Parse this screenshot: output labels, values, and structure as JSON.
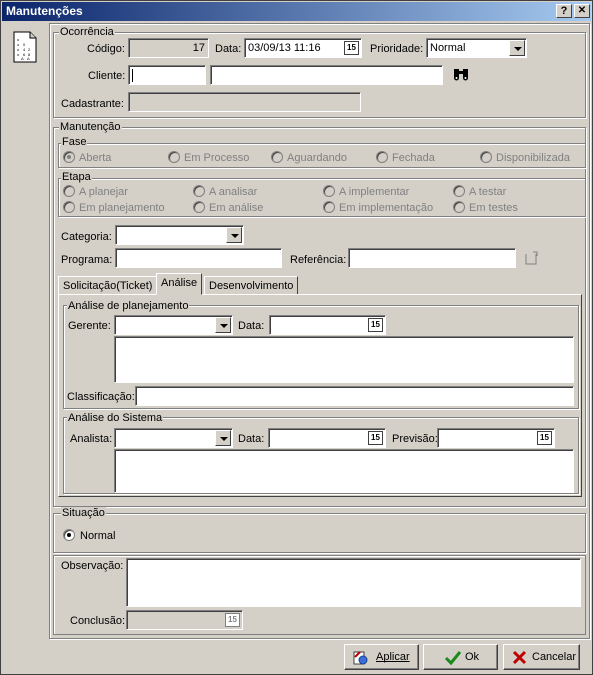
{
  "window": {
    "title": "Manutenções",
    "help_label": "?",
    "close_label": "✕"
  },
  "ocorrencia": {
    "group_label": "Ocorrência",
    "codigo_label": "Código:",
    "codigo_value": "17",
    "data_label": "Data:",
    "data_value": "03/09/13 11:16",
    "prioridade_label": "Prioridade:",
    "prioridade_value": "Normal",
    "cliente_label": "Cliente:",
    "cliente_code": "",
    "cliente_name": "",
    "cadastrante_label": "Cadastrante:",
    "cadastrante_value": ""
  },
  "manutencao": {
    "group_label": "Manutenção",
    "fase_label": "Fase",
    "fase_options": [
      "Aberta",
      "Em Processo",
      "Aguardando",
      "Fechada",
      "Disponibilizada"
    ],
    "fase_selected": "Aberta",
    "etapa_label": "Etapa",
    "etapa_options": [
      "A planejar",
      "A analisar",
      "A implementar",
      "A testar",
      "Em planejamento",
      "Em análise",
      "Em implementação",
      "Em testes"
    ],
    "categoria_label": "Categoria:",
    "categoria_value": "",
    "programa_label": "Programa:",
    "programa_value": "",
    "referencia_label": "Referência:",
    "referencia_value": ""
  },
  "tabs": [
    {
      "label": "Solicitação(Ticket)"
    },
    {
      "label": "Análise"
    },
    {
      "label": "Desenvolvimento"
    }
  ],
  "active_tab": "Análise",
  "analise_planejamento": {
    "group_label": "Análise de planejamento",
    "gerente_label": "Gerente:",
    "gerente_value": "",
    "data_label": "Data:",
    "data_value": "",
    "classificacao_label": "Classificação:",
    "classificacao_value": ""
  },
  "analise_sistema": {
    "group_label": "Análise do Sistema",
    "analista_label": "Analista:",
    "analista_value": "",
    "data_label": "Data:",
    "data_value": "",
    "previsao_label": "Previsão:",
    "previsao_value": ""
  },
  "situacao": {
    "group_label": "Situação",
    "option": "Normal"
  },
  "observacao_label": "Observação:",
  "observacao_value": "",
  "conclusao_label": "Conclusão:",
  "conclusao_value": "",
  "buttons": {
    "aplicar": "Aplicar",
    "ok": "Ok",
    "cancelar": "Cancelar"
  },
  "icons": {
    "form": "document-icon",
    "search": "binoculars-icon",
    "calendar": "calendar-icon",
    "new_ref": "new-document-icon",
    "aplicar": "apply-icon",
    "ok": "checkmark-icon",
    "cancelar": "red-x-icon"
  },
  "colors": {
    "title_start": "#0a246a",
    "title_end": "#a6caf0",
    "ok_check": "#1a8a1a",
    "cancel_x": "#c00000"
  }
}
